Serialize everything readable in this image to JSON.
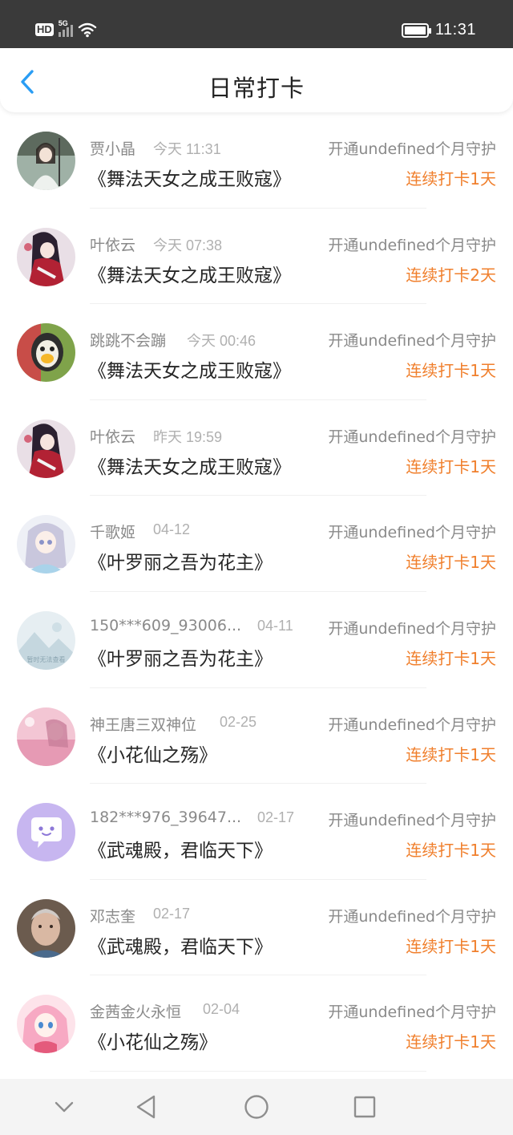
{
  "status_bar": {
    "network_label": "HD",
    "signal_label": "5G",
    "wifi_icon": "wifi-icon",
    "battery_icon": "battery-icon",
    "time": "11:31"
  },
  "header": {
    "back_icon": "chevron-left-icon",
    "title": "日常打卡"
  },
  "items": [
    {
      "name": "贾小晶",
      "time": "今天 11:31",
      "guard": "开通undefined个月守护",
      "book": "《舞法天女之成王败寇》",
      "streak": "连续打卡1天"
    },
    {
      "name": "叶依云",
      "time": "今天 07:38",
      "guard": "开通undefined个月守护",
      "book": "《舞法天女之成王败寇》",
      "streak": "连续打卡2天"
    },
    {
      "name": "跳跳不会蹦",
      "time": "今天 00:46",
      "guard": "开通undefined个月守护",
      "book": "《舞法天女之成王败寇》",
      "streak": "连续打卡1天"
    },
    {
      "name": "叶依云",
      "time": "昨天 19:59",
      "guard": "开通undefined个月守护",
      "book": "《舞法天女之成王败寇》",
      "streak": "连续打卡1天"
    },
    {
      "name": "千歌姬",
      "time": "04-12",
      "guard": "开通undefined个月守护",
      "book": "《叶罗丽之吾为花主》",
      "streak": "连续打卡1天"
    },
    {
      "name": "150***609_93006...",
      "time": "04-11",
      "guard": "开通undefined个月守护",
      "book": "《叶罗丽之吾为花主》",
      "streak": "连续打卡1天",
      "avatar_caption": "暂时无法查看"
    },
    {
      "name": "神王唐三双神位",
      "time": "02-25",
      "guard": "开通undefined个月守护",
      "book": "《小花仙之殇》",
      "streak": "连续打卡1天"
    },
    {
      "name": "182***976_39647...",
      "time": "02-17",
      "guard": "开通undefined个月守护",
      "book": "《武魂殿，君临天下》",
      "streak": "连续打卡1天"
    },
    {
      "name": "邓志奎",
      "time": "02-17",
      "guard": "开通undefined个月守护",
      "book": "《武魂殿，君临天下》",
      "streak": "连续打卡1天"
    },
    {
      "name": "金茜金火永恒",
      "time": "02-04",
      "guard": "开通undefined个月守护",
      "book": "《小花仙之殇》",
      "streak": "连续打卡1天"
    }
  ],
  "colors": {
    "accent_blue": "#2a9df4",
    "streak_orange": "#f07f2c",
    "status_bar_bg": "#3a3a3a"
  },
  "nav_bar": {
    "icons": [
      "chevron-down-icon",
      "back-triangle-icon",
      "home-circle-icon",
      "recents-square-icon"
    ]
  }
}
